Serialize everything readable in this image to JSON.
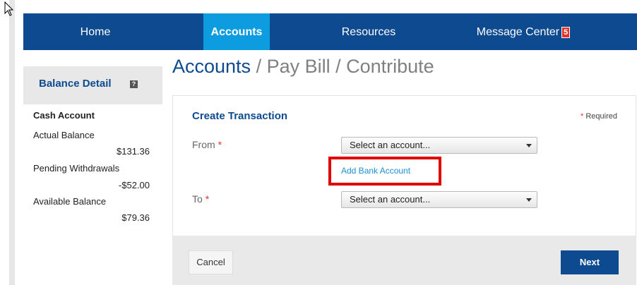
{
  "nav": {
    "items": [
      {
        "label": "Home"
      },
      {
        "label": "Accounts"
      },
      {
        "label": "Resources"
      },
      {
        "label": "Message Center"
      }
    ],
    "message_badge": "5"
  },
  "page": {
    "title_main": "Accounts",
    "title_rest": " / Pay Bill / Contribute"
  },
  "sidebar": {
    "title": "Balance Detail",
    "help_glyph": "?",
    "account_name": "Cash Account",
    "rows": [
      {
        "label": "Actual Balance",
        "value": "$131.36"
      },
      {
        "label": "Pending Withdrawals",
        "value": "-$52.00"
      },
      {
        "label": "Available Balance",
        "value": "$79.36"
      }
    ]
  },
  "form": {
    "title": "Create Transaction",
    "required_asterisk": "*",
    "required_label": " Required",
    "from_label": "From",
    "to_label": "To",
    "from_select": "Select an account...",
    "to_select": "Select an account...",
    "add_bank_link": "Add Bank Account"
  },
  "footer": {
    "cancel_label": "Cancel",
    "next_label": "Next"
  },
  "colors": {
    "nav_bg": "#0d4a8f",
    "nav_active": "#0e9ce0",
    "link": "#1a8fd6",
    "highlight": "#e00000"
  }
}
